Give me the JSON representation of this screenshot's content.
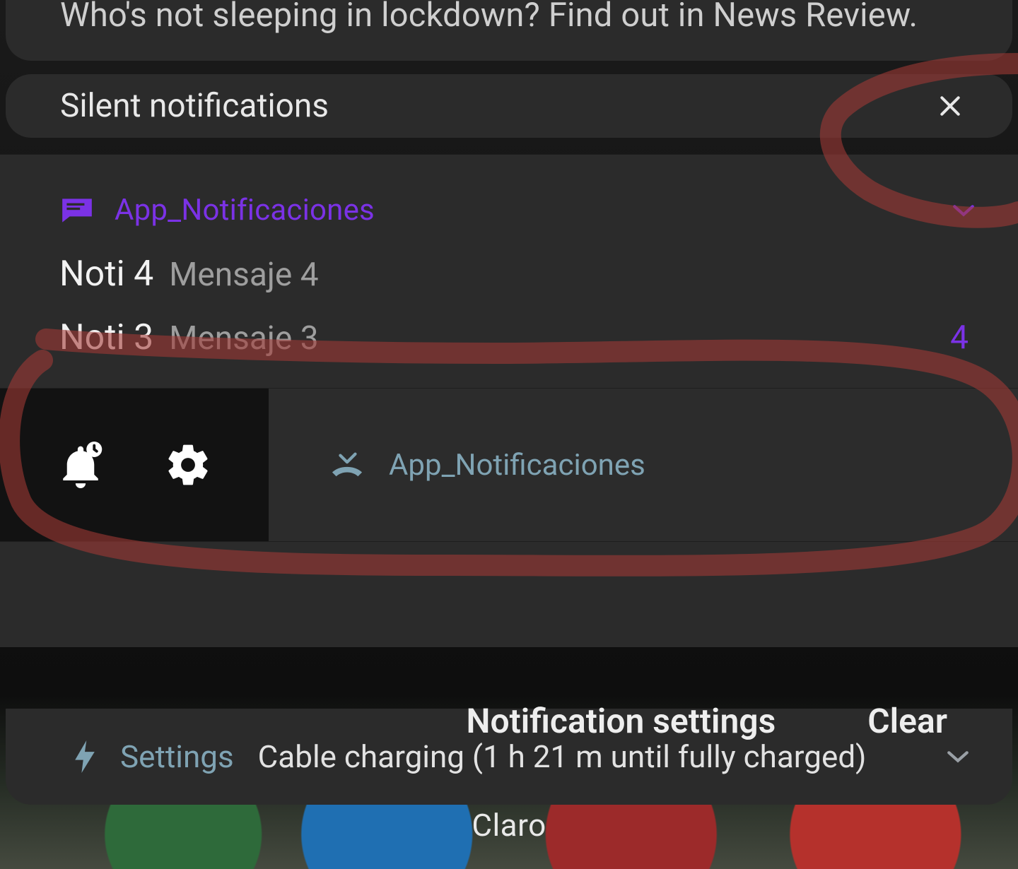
{
  "colors": {
    "accent_purple": "#7b32e6",
    "accent_teal": "#7fa3b3",
    "annotation_red": "#a33a36"
  },
  "top_notification": {
    "text": "Who's not sleeping in lockdown? Find out in News Review."
  },
  "silent_header": {
    "title": "Silent notifications",
    "close_icon": "close-icon"
  },
  "app_group": {
    "icon": "messages-icon",
    "app_name": "App_Notificaciones",
    "expand_icon": "chevron-down-icon",
    "items": [
      {
        "title": "Noti 4",
        "message": "Mensaje 4"
      },
      {
        "title": "Noti 3",
        "message": "Mensaje 3"
      }
    ],
    "count": "4"
  },
  "action_row": {
    "snooze_icon": "bell-snooze-icon",
    "settings_icon": "gear-icon",
    "missed_icon": "missed-call-icon",
    "missed_app": "App_Notificaciones"
  },
  "charging_card": {
    "bolt_icon": "lightning-icon",
    "settings_label": "Settings",
    "status_text": "Cable charging (1 h 21 m until fully charged)",
    "expand_icon": "chevron-down-icon"
  },
  "bottom_actions": {
    "settings_label": "Notification settings",
    "clear_label": "Clear"
  },
  "carrier": {
    "name": "Claro"
  }
}
